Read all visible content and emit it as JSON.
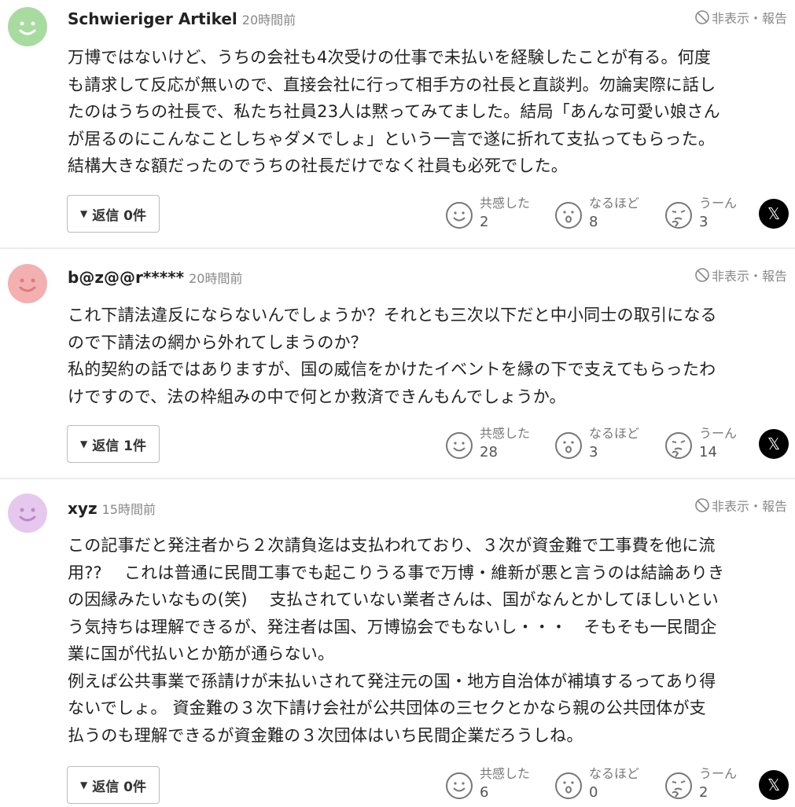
{
  "report_label": "非表示・報告",
  "reaction_labels": {
    "empathy": "共感した",
    "insight": "なるほど",
    "hmm": "うーん"
  },
  "share_icon": "x-logo-icon",
  "comments": [
    {
      "author": "Schwieriger Artikel",
      "time": "20時間前",
      "avatar_color": "#a8dba0",
      "avatar_face_color": "#ffffff",
      "body": "万博ではないけど、うちの会社も4次受けの仕事で未払いを経験したことが有る。何度\nも請求して反応が無いので、直接会社に行って相手方の社長と直談判。勿論実際に話し\nたのはうちの社長で、私たち社員23人は黙ってみてました。結局「あんな可愛い娘さん\nが居るのにこんなことしちゃダメでしょ」という一言で遂に折れて支払ってもらった。\n結構大きな額だったのでうちの社長だけでなく社員も必死でした。",
      "reply_label": "返信 0件",
      "empathy": "2",
      "insight": "8",
      "hmm": "3"
    },
    {
      "author": "b@z@@r*****",
      "time": "20時間前",
      "avatar_color": "#f2b0b0",
      "avatar_face_color": "#e07a7a",
      "body": "これ下請法違反にならないんでしょうか？それとも三次以下だと中小同士の取引になる\nので下請法の網から外れてしまうのか？\n私的契約の話ではありますが、国の威信をかけたイベントを縁の下で支えてもらったわ\nけですので、法の枠組みの中で何とか救済できんもんでしょうか。",
      "reply_label": "返信 1件",
      "empathy": "28",
      "insight": "3",
      "hmm": "14"
    },
    {
      "author": "xyz",
      "time": "15時間前",
      "avatar_color": "#e6c8ee",
      "avatar_face_color": "#b98ac7",
      "body": "この記事だと発注者から２次請負迄は支払われており、３次が資金難で工事費を他に流\n用??　 これは普通に民間工事でも起こりうる事で万博・維新が悪と言うのは結論ありき\nの因縁みたいなもの(笑)　 支払されていない業者さんは、国がなんとかしてほしいとい\nう気持ちは理解できるが、発注者は国、万博協会でもないし・・・　そもそも一民間企\n業に国が代払いとか筋が通らない。\n例えば公共事業で孫請けが未払いされて発注元の国・地方自治体が補填するってあり得\nないでしょ。 資金難の３次下請け会社が公共団体の三セクとかなら親の公共団体が支\n払うのも理解できるが資金難の３次団体はいち民間企業だろうしね。",
      "reply_label": "返信 0件",
      "empathy": "6",
      "insight": "0",
      "hmm": "2"
    }
  ]
}
